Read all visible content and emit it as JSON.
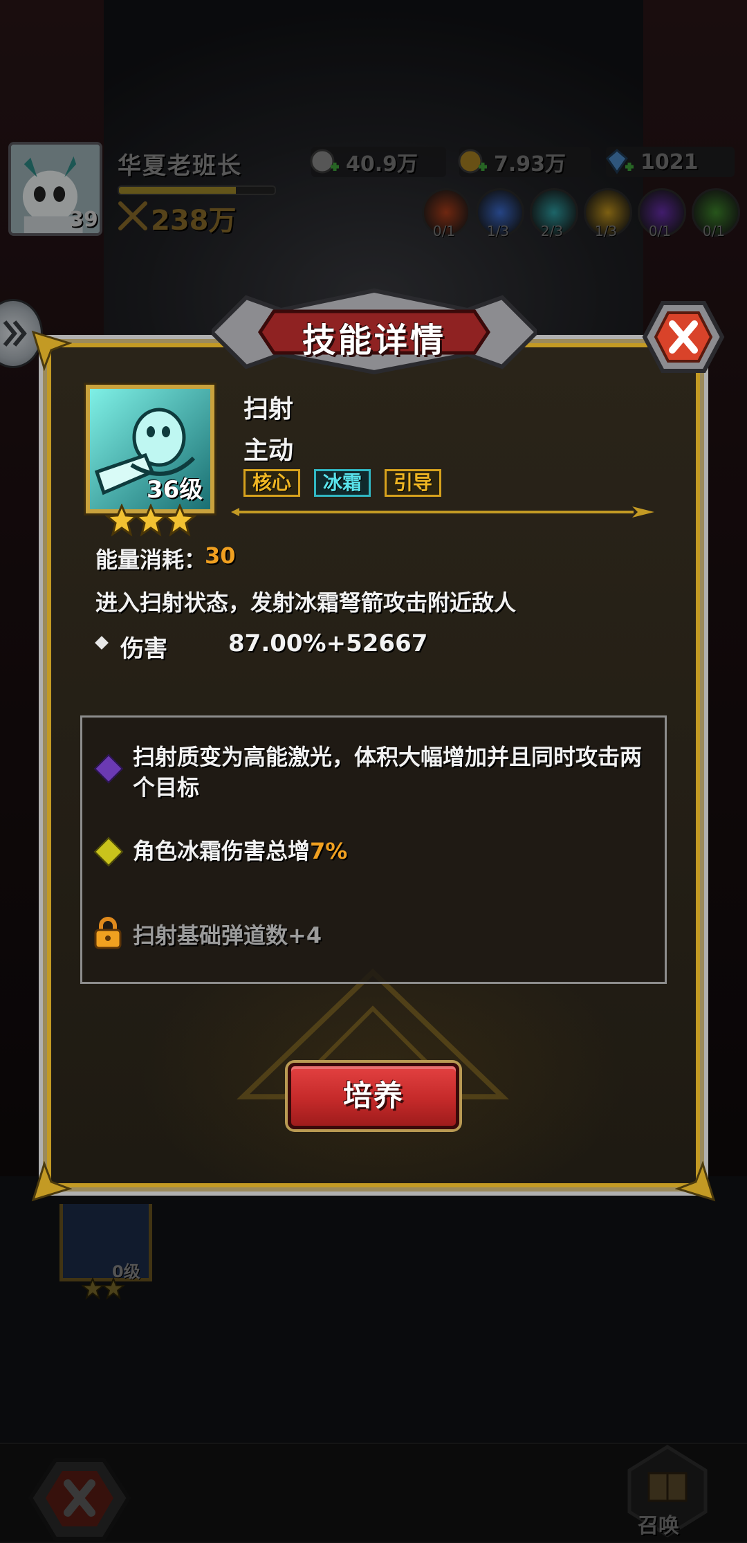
{
  "player": {
    "name": "华夏老班长",
    "level": "39",
    "power": "238万",
    "exp_fraction": 0.75
  },
  "currencies": [
    {
      "icon": "silver-coin-icon",
      "value": "40.9万"
    },
    {
      "icon": "gold-coin-icon",
      "value": "7.93万"
    },
    {
      "icon": "crystal-icon",
      "value": "1021"
    }
  ],
  "buffs": [
    {
      "icon": "fire-buff-icon",
      "count": "0/1",
      "color": "#b3401c"
    },
    {
      "icon": "claw-buff-icon",
      "count": "1/3",
      "color": "#3d6fd6"
    },
    {
      "icon": "snowflake-buff-icon",
      "count": "2/3",
      "color": "#2fa3a8"
    },
    {
      "icon": "sun-buff-icon",
      "count": "1/3",
      "color": "#c99a1d"
    },
    {
      "icon": "moon-buff-icon",
      "count": "0/1",
      "color": "#6a2fb0"
    },
    {
      "icon": "leaf-buff-icon",
      "count": "0/1",
      "color": "#3f8a2c"
    }
  ],
  "dialog": {
    "title": "技能详情",
    "skill": {
      "name": "扫射",
      "type": "主动",
      "level_label": "36级",
      "stars": 3,
      "tags": [
        "核心",
        "冰霜",
        "引导"
      ],
      "energy_label": "能量消耗：",
      "energy_value": "30",
      "description": "进入扫射状态，发射冰霜弩箭攻击附近敌人",
      "damage_label": "伤害",
      "damage_value": "87.00%+52667"
    },
    "passives": [
      {
        "text": "扫射质变为高能激光，体积大幅增加并且同时攻击两个目标",
        "locked": false
      },
      {
        "text_before": "角色冰霜伤害总增",
        "highlight": "7%",
        "locked": false
      },
      {
        "text": "扫射基础弹道数+4",
        "locked": true
      }
    ],
    "button_label": "培养"
  },
  "behind_card": {
    "level_label": "0级",
    "stars": 2
  },
  "bottom_nav": {
    "summon_label": "召唤"
  },
  "colors": {
    "gold_frame": "#c39a24",
    "highlight_orange": "#f0a020",
    "frost_cyan": "#59e3ec",
    "button_red": "#c52a2a"
  }
}
